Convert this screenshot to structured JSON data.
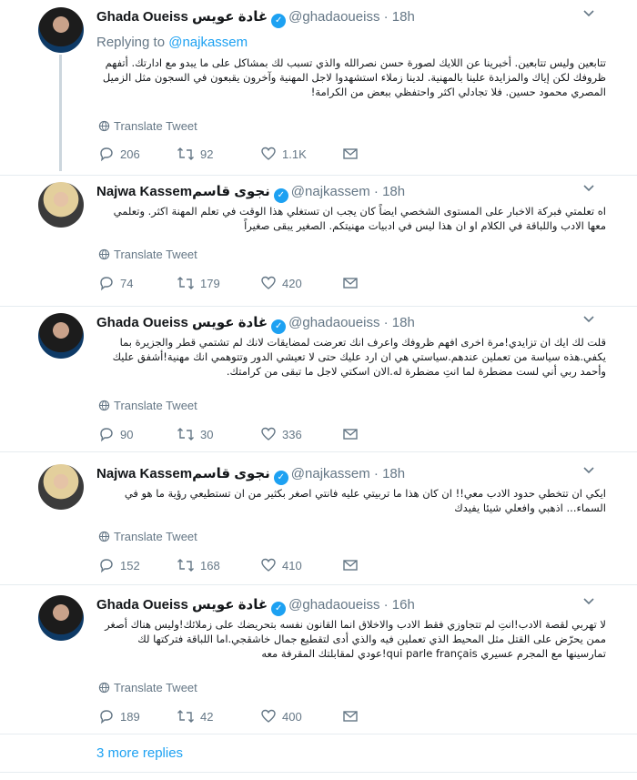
{
  "translate_label": "Translate Tweet",
  "more_replies": "3 more replies",
  "tweets": [
    {
      "name": "Ghada Oueiss",
      "arabic_name": "غادة عويس",
      "handle": "@ghadaoueiss",
      "dot": "·",
      "time": "18h",
      "replying_prefix": "Replying to",
      "replying_to": "@najkassem",
      "text": "تتابعين وليس تتابعين. أخبرينا عن اللايك لصورة حسن نصرالله والذي تسبب لك بمشاكل على ما يبدو مع ادارتك. أتفهم ظروفك لكن إياك والمزايدة علينا بالمهنية. لدينا زملاء استشهدوا لاجل المهنية وآخرون يقبعون في السجون مثل الزميل المصري محمود حسين. فلا تجادلي اكثر واحتفظي ببعض من الكرامة!",
      "replies": "206",
      "retweets": "92",
      "likes": "1.1K"
    },
    {
      "name": "Najwa Kassem",
      "arabic_name": "نجوى قاسم",
      "handle": "@najkassem",
      "dot": "·",
      "time": "18h",
      "text": "اه تعلمتي فبركة الاخبار على المستوى الشخصي ايضاً كان يجب ان تستغلي هذا الوقت في تعلم المهنة اكثر. وتعلمي معها الادب واللباقة في الكلام او ان هذا ليس في ادبيات مهنيتكم. الصغير يبقى صغيراً",
      "replies": "74",
      "retweets": "179",
      "likes": "420"
    },
    {
      "name": "Ghada Oueiss",
      "arabic_name": "غادة عويس",
      "handle": "@ghadaoueiss",
      "dot": "·",
      "time": "18h",
      "text": "قلت لك ايك ان تزايدي!مرة اخرى افهم ظروفك واعرف انك تعرضت لمضايقات لانك لم تشتمي قطر والجزيرة بما يكفي.هذه سياسة من تعملين عندهم.سياستي هي ان ارد عليك حتى لا تعيشي الدور وتتوهمي انك مهنية!أشفق عليك وأحمد ربي أني لست مضطرة لما انتِ مضطرة له.الان اسكتي لاجل ما تبقى من كرامتك.",
      "replies": "90",
      "retweets": "30",
      "likes": "336"
    },
    {
      "name": "Najwa Kassem",
      "arabic_name": "نجوى قاسم",
      "handle": "@najkassem",
      "dot": "·",
      "time": "18h",
      "text": "ايكي ان تتخطي حدود الادب معي!! ان كان هذا ما تربيتي عليه فانتي اصغر بكثير من ان تستطيعي رؤية ما هو في السماء... اذهبي وافعلي شيئا يفيدك",
      "replies": "152",
      "retweets": "168",
      "likes": "410"
    },
    {
      "name": "Ghada Oueiss",
      "arabic_name": "غادة عويس",
      "handle": "@ghadaoueiss",
      "dot": "·",
      "time": "16h",
      "text": "لا تهربي لقصة الادب!انتِ لم تتجاوزي فقط الادب والاخلاق انما القانون نفسه بتحريضك على زملائك!وليس هناك أصغر ممن يحرّض على القتل مثل المحيط الذي تعملين فيه والذي أدى لتقطيع جمال خاشقجي.اما اللباقة فتركتها لك تمارسينها مع المجرم عسيري qui parle français!عودي لمقابلتك المقرفة معه",
      "replies": "189",
      "retweets": "42",
      "likes": "400"
    }
  ]
}
